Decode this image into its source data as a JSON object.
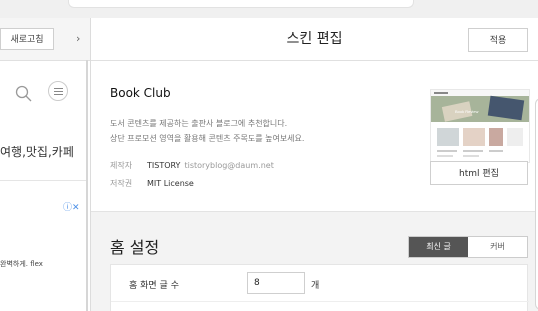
{
  "left_panel": {
    "refresh_label": "새로고침",
    "collapse_glyph": "›",
    "preview_categories": "여행,맛집,카페",
    "ad_badge": "ⓘ✕",
    "preview_snippet": "완벽하게. flex"
  },
  "header": {
    "title": "스킨 편집",
    "apply_label": "적용"
  },
  "skin": {
    "name": "Book Club",
    "desc_line1": "도서 콘텐츠를 제공하는 출판사 블로그에 추천합니다.",
    "desc_line2": "상단 프로모션 영역을 활용해 콘텐츠 주목도를 높여보세요.",
    "maker_key": "제작자",
    "maker_value": "TISTORY",
    "maker_email": "tistoryblog@daum.net",
    "license_key": "저작권",
    "license_value": "MIT License",
    "html_edit_label": "html 편집",
    "thumb_hero_text": "Book Review"
  },
  "home_settings": {
    "title": "홈 설정",
    "tabs": [
      {
        "label": "최신 글",
        "active": true
      },
      {
        "label": "커버",
        "active": false
      }
    ],
    "post_count_label": "홈 화면 글 수",
    "post_count_value": "8",
    "post_count_unit": "개"
  },
  "colors": {
    "active_tab": "#555555",
    "ad_badge": "#4a8fe7"
  }
}
